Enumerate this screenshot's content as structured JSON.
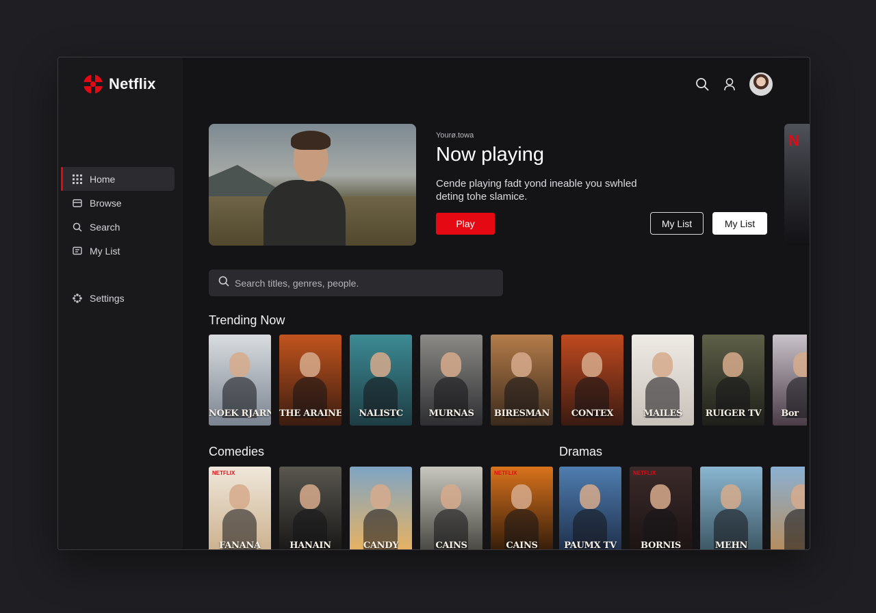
{
  "app": {
    "brand": "Netflix",
    "accent": "#e50914"
  },
  "sidebar": {
    "items": [
      {
        "label": "Home",
        "icon": "grid-icon",
        "active": true
      },
      {
        "label": "Browse",
        "icon": "browse-icon",
        "active": false
      },
      {
        "label": "Search",
        "icon": "search-icon",
        "active": false
      },
      {
        "label": "My List",
        "icon": "list-icon",
        "active": false
      },
      {
        "label": "Settings",
        "icon": "settings-icon",
        "active": false
      }
    ]
  },
  "header": {
    "icons": [
      "search-icon",
      "profile-icon",
      "avatar"
    ]
  },
  "hero": {
    "kicker": "Yourø.towa",
    "title": "Now playing",
    "description": "Cende playing fadt yond ineable you swhled deting tohe slamice.",
    "play_label": "Play",
    "mylist_outline_label": "My List",
    "mylist_solid_label": "My List"
  },
  "search": {
    "placeholder": "Search titles, genres, people."
  },
  "rows": {
    "trending": {
      "title": "Trending Now",
      "posters": [
        {
          "title": "NOEK RJARN",
          "bg": [
            "#d9dde0",
            "#7a8390"
          ]
        },
        {
          "title": "THE ARAINE",
          "bg": [
            "#c2541e",
            "#3a1c10"
          ]
        },
        {
          "title": "NALISTC",
          "bg": [
            "#3d8b94",
            "#1e3d44"
          ]
        },
        {
          "title": "MURNAS",
          "bg": [
            "#8b8a86",
            "#2d2e31"
          ]
        },
        {
          "title": "BIRESMAN",
          "bg": [
            "#b47c4a",
            "#3b2a1c"
          ]
        },
        {
          "title": "CONTEX",
          "bg": [
            "#c04a1f",
            "#3a1a12"
          ]
        },
        {
          "title": "MAILES",
          "bg": [
            "#eeeae4",
            "#c9c2bb"
          ]
        },
        {
          "title": "RUIGER TV",
          "bg": [
            "#5e6048",
            "#1e1f1a"
          ]
        },
        {
          "title": "Bor",
          "bg": [
            "#c9c2c9",
            "#4a3d48"
          ]
        }
      ]
    },
    "comedies": {
      "title": "Comedies",
      "posters": [
        {
          "title": "FANANA",
          "badge": "NETFLIX",
          "bg": [
            "#efe7db",
            "#c9ad88"
          ]
        },
        {
          "title": "HANAIN",
          "bg": [
            "#59574f",
            "#141313"
          ]
        },
        {
          "title": "CANDY",
          "bg": [
            "#7ea4c4",
            "#f0b35a"
          ]
        },
        {
          "title": "CAINS",
          "bg": [
            "#c8c7bf",
            "#3f3e38"
          ]
        },
        {
          "title": "CAINS",
          "badge": "NETFLIX",
          "bg": [
            "#d9731d",
            "#281608"
          ]
        }
      ]
    },
    "dramas": {
      "title": "Dramas",
      "posters": [
        {
          "title": "PAUMX TV",
          "bg": [
            "#4f7eb0",
            "#1b2a45"
          ]
        },
        {
          "title": "BORNIS",
          "badge": "NETFLIX",
          "bg": [
            "#3b2a2a",
            "#1a1212"
          ]
        },
        {
          "title": "MEHN",
          "bg": [
            "#8ab6d0",
            "#37505d"
          ]
        },
        {
          "title": "",
          "bg": [
            "#8bb0d2",
            "#b88a55"
          ]
        }
      ]
    }
  }
}
